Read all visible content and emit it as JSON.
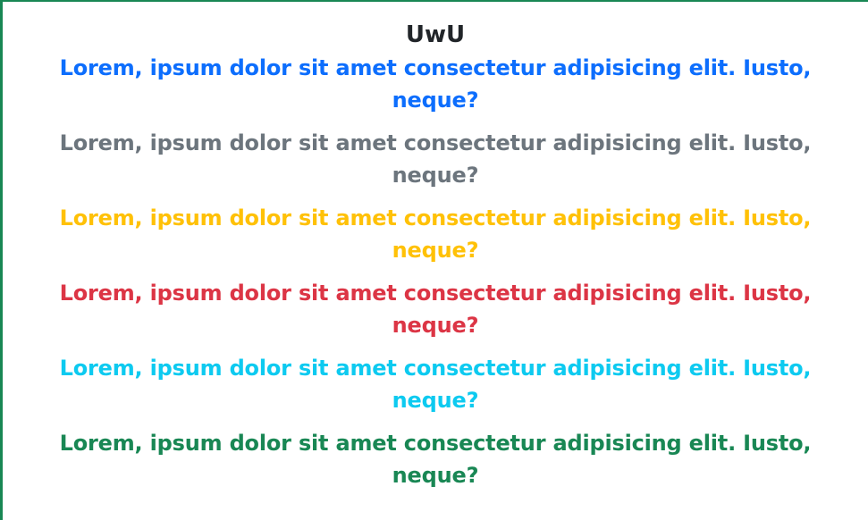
{
  "page": {
    "title": "UwU",
    "lines": [
      {
        "text": "Lorem, ipsum dolor sit amet consectetur adipisicing elit. Iusto, neque?",
        "color": "#0d6efd"
      },
      {
        "text": "Lorem, ipsum dolor sit amet consectetur adipisicing elit. Iusto, neque?",
        "color": "#6c757d"
      },
      {
        "text": "Lorem, ipsum dolor sit amet consectetur adipisicing elit. Iusto, neque?",
        "color": "#ffc107"
      },
      {
        "text": "Lorem, ipsum dolor sit amet consectetur adipisicing elit. Iusto, neque?",
        "color": "#dc3545"
      },
      {
        "text": "Lorem, ipsum dolor sit amet consectetur adipisicing elit. Iusto, neque?",
        "color": "#0dcaf0"
      },
      {
        "text": "Lorem, ipsum dolor sit amet consectetur adipisicing elit. Iusto, neque?",
        "color": "#198754"
      }
    ]
  },
  "theme": {
    "border_color": "#198754",
    "title_color": "#212529",
    "background": "#ffffff"
  }
}
